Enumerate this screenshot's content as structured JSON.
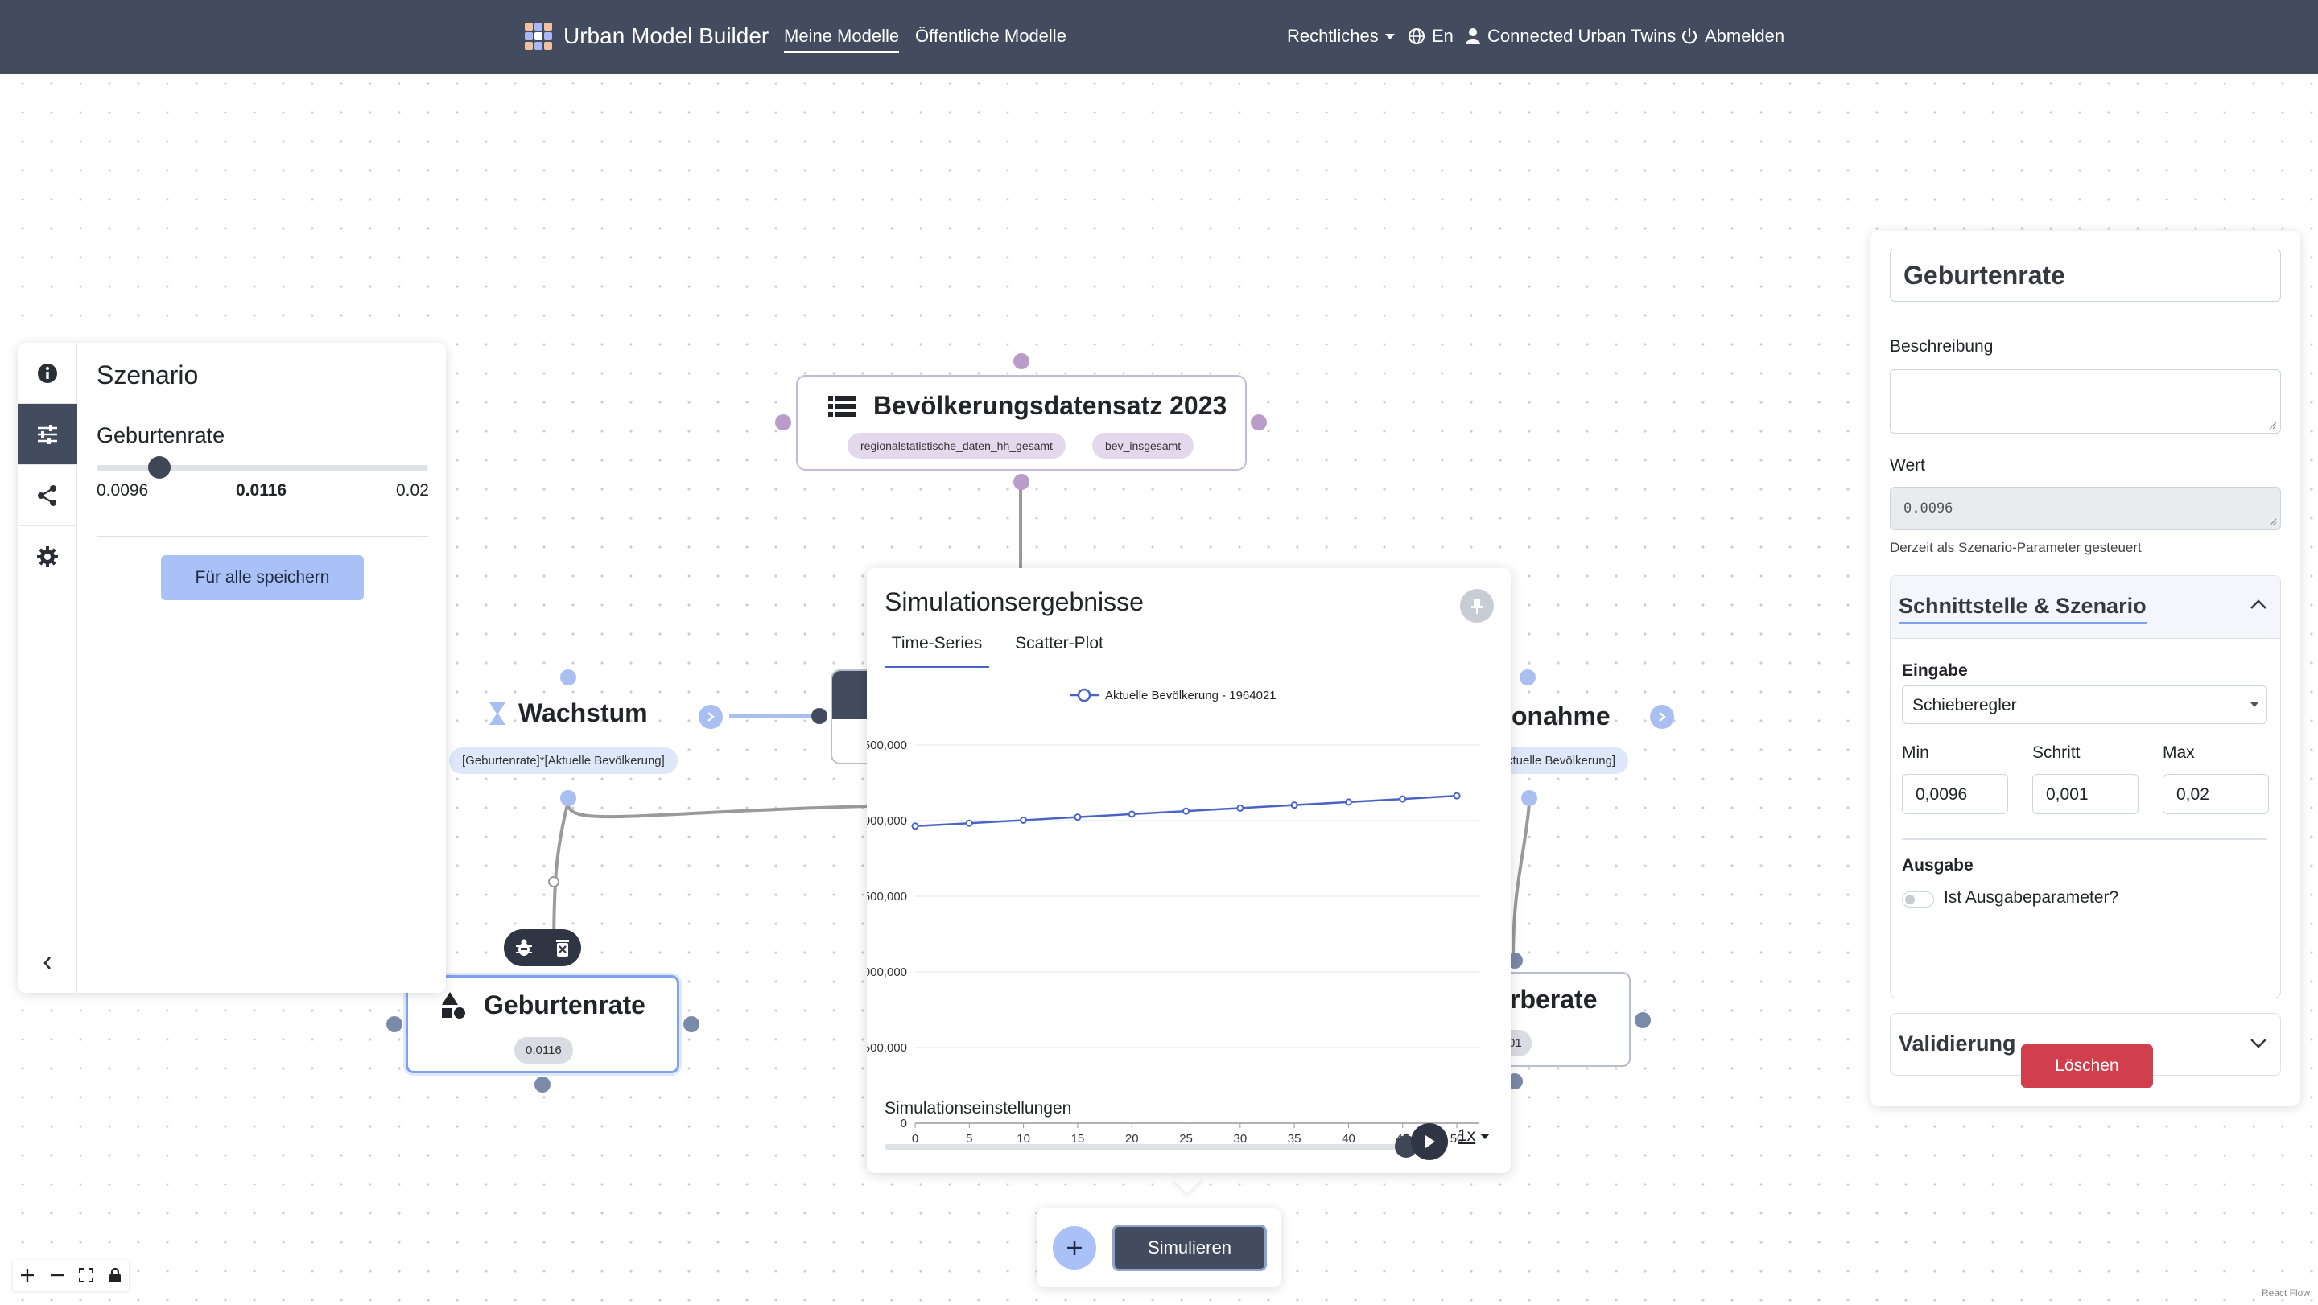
{
  "nav": {
    "brand": "Urban Model Builder",
    "links": [
      "Meine Modelle",
      "Öffentliche Modelle"
    ],
    "legal": "Rechtliches",
    "language": "En",
    "user": "Connected Urban Twins",
    "logout": "Abmelden"
  },
  "nodes": {
    "dataset": {
      "title": "Bevölkerungsdatensatz 2023",
      "chips": [
        "regionalstatistische_daten_hh_gesamt",
        "bev_insgesamt"
      ]
    },
    "growth": {
      "title": "Wachstum",
      "formula": "[Geburtenrate]*[Aktuelle Bevölkerung]"
    },
    "decline": {
      "title": "onahme",
      "formula": "ktuelle Bevölkerung]"
    },
    "birthrate": {
      "title": "Geburtenrate",
      "value": "0.0116"
    },
    "deathrate": {
      "title": "rberate",
      "value": "01"
    }
  },
  "scenario": {
    "title": "Szenario",
    "param_name": "Geburtenrate",
    "min": "0.0096",
    "current": "0.0116",
    "max": "0.02",
    "save_button": "Für alle speichern",
    "slider_fraction": 0.19
  },
  "simulation": {
    "title": "Simulationsergebnisse",
    "tabs": [
      "Time-Series",
      "Scatter-Plot"
    ],
    "settings_label": "Simulationseinstellungen",
    "speed": "1x",
    "progress_fraction": 1.0
  },
  "chart_data": {
    "type": "line",
    "title": "",
    "xlabel": "",
    "ylabel": "",
    "legend": "top",
    "grid": true,
    "series": [
      {
        "name": "Aktuelle Bevölkerung - 1964021",
        "x": [
          0,
          5,
          10,
          15,
          20,
          25,
          30,
          35,
          40,
          45,
          50
        ],
        "values": [
          1964021,
          1983000,
          2003000,
          2023000,
          2043000,
          2063000,
          2083000,
          2103000,
          2123000,
          2143000,
          2164000
        ]
      }
    ],
    "xticks": [
      "0",
      "5",
      "10",
      "15",
      "20",
      "25",
      "30",
      "35",
      "40",
      "45",
      "50"
    ],
    "yticks": [
      "0",
      "500,000",
      ",000,000",
      ",500,000",
      "2,000,000",
      "2,500,000"
    ],
    "xlim": [
      0,
      52
    ],
    "ylim": [
      0,
      2500000
    ]
  },
  "props": {
    "name": "Geburtenrate",
    "description_label": "Beschreibung",
    "description": "",
    "value_label": "Wert",
    "value": "0.0096",
    "value_hint": "Derzeit als Szenario-Parameter gesteuert",
    "interface_section": "Schnittstelle & Szenario",
    "input_label": "Eingabe",
    "input_type": "Schieberegler",
    "min_label": "Min",
    "step_label": "Schritt",
    "max_label": "Max",
    "min": "0,0096",
    "step": "0,001",
    "max": "0,02",
    "output_label": "Ausgabe",
    "output_toggle": "Ist Ausgabeparameter?",
    "validation_section": "Validierung",
    "delete_button": "Löschen"
  },
  "toolbar": {
    "simulate": "Simulieren"
  },
  "attribution": "React Flow",
  "colors": {
    "navbar": "#434c5e",
    "accent_blue": "#4a63c9",
    "danger": "#d23f4c",
    "save_button": "#a9c1f6"
  }
}
